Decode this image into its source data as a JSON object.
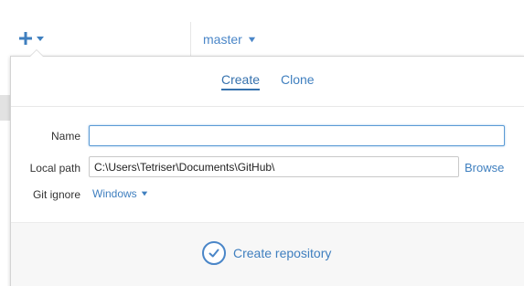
{
  "toolbar": {
    "add_icon": "plus-icon",
    "add_dropdown_icon": "caret-down-icon",
    "branch": {
      "label": "master",
      "icon": "caret-down-icon"
    }
  },
  "colors": {
    "accent": "#3f7fbf",
    "accent_dark": "#3672ae",
    "input_focus": "#5b9bd5",
    "footer_bg": "#f7f7f7"
  },
  "popover": {
    "tabs": [
      {
        "label": "Create",
        "active": true
      },
      {
        "label": "Clone",
        "active": false
      }
    ],
    "form": {
      "name": {
        "label": "Name",
        "value": "",
        "placeholder": ""
      },
      "local_path": {
        "label": "Local path",
        "value": "C:\\Users\\Tetriser\\Documents\\GitHub\\",
        "browse_label": "Browse"
      },
      "git_ignore": {
        "label": "Git ignore",
        "value": "Windows",
        "icon": "caret-down-icon"
      }
    },
    "footer": {
      "button_label": "Create repository",
      "button_icon": "checkmark-circle-icon"
    }
  }
}
